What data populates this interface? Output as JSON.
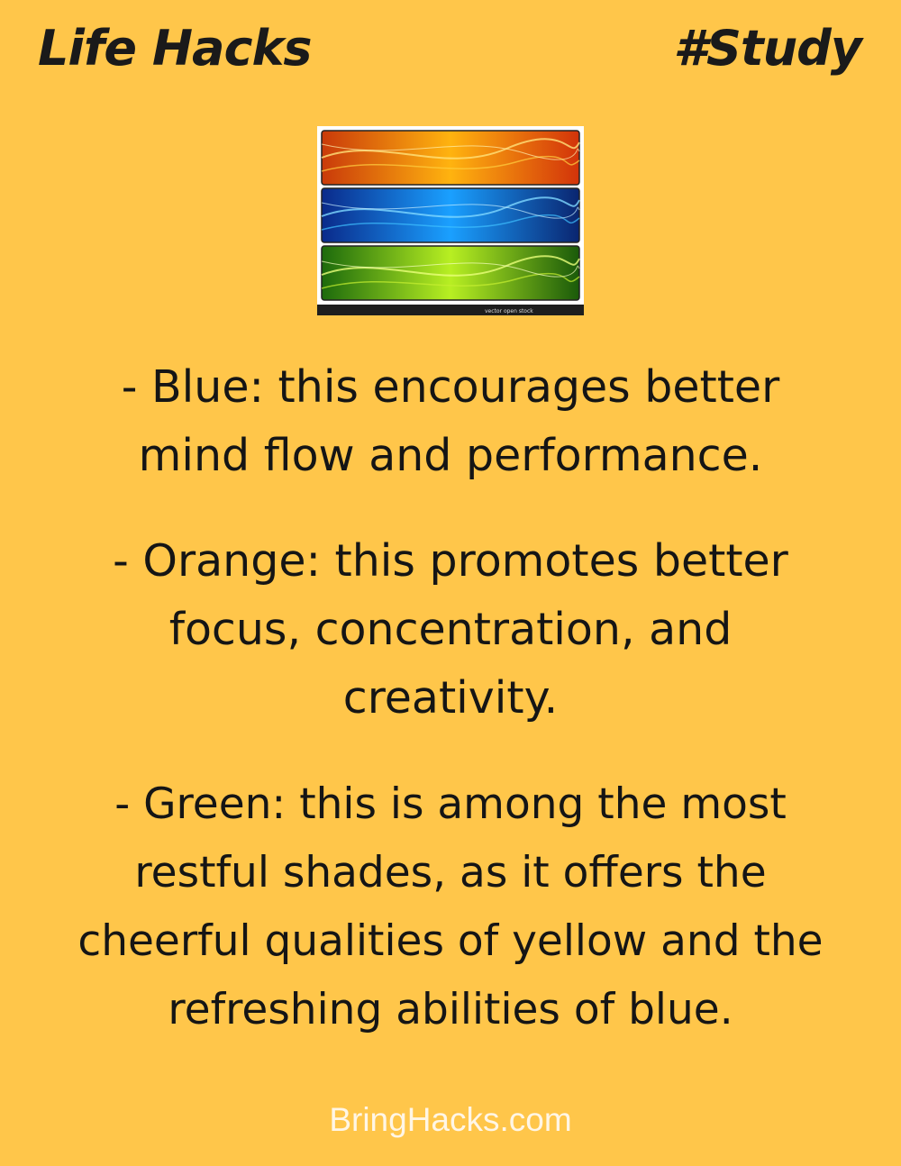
{
  "header": {
    "left_title": "Life Hacks",
    "right_tag": "#Study"
  },
  "image": {
    "banners": [
      "orange-banner",
      "blue-banner",
      "green-banner"
    ],
    "credit": "vector open stock"
  },
  "tips": [
    "- Blue: this encourages better\nmind flow and performance.",
    "- Orange: this promotes better\nfocus, concentration, and\ncreativity.",
    "- Green: this is among the most\nrestful shades, as it offers the\ncheerful qualities of yellow and the\nrefreshing abilities of blue."
  ],
  "footer": {
    "site": "BringHacks.com"
  },
  "colors": {
    "background": "#ffc64a",
    "text": "#151515",
    "footer": "#fff6e6"
  }
}
